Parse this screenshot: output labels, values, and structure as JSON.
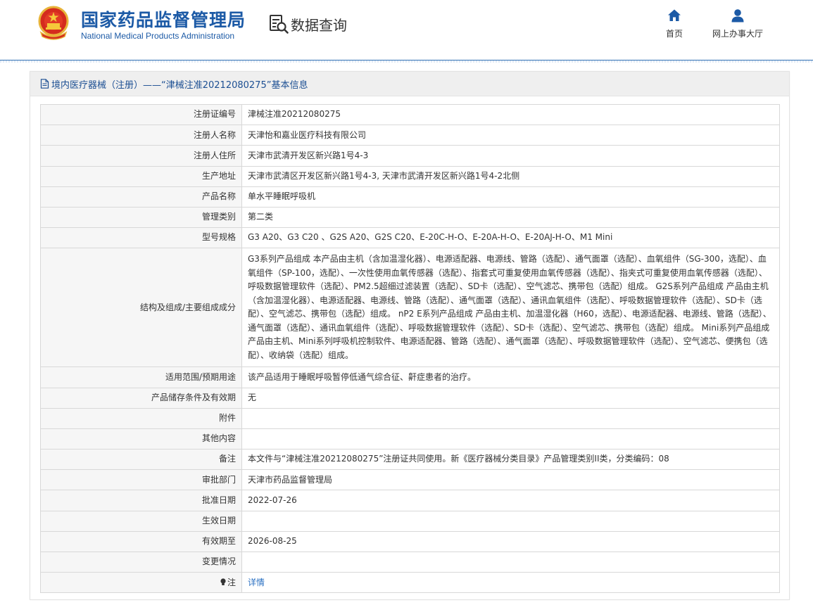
{
  "header": {
    "logo_cn": "国家药品监督管理局",
    "logo_en": "National Medical Products Administration",
    "query_label": "数据查询",
    "nav": [
      {
        "label": "首页",
        "icon": "home-icon"
      },
      {
        "label": "网上办事大厅",
        "icon": "user-icon"
      }
    ]
  },
  "panel": {
    "title": "境内医疗器械（注册）——“津械注准20212080275”基本信息"
  },
  "rows": [
    {
      "label": "注册证编号",
      "value": "津械注准20212080275"
    },
    {
      "label": "注册人名称",
      "value": "天津怡和嘉业医疗科技有限公司"
    },
    {
      "label": "注册人住所",
      "value": "天津市武清开发区新兴路1号4-3"
    },
    {
      "label": "生产地址",
      "value": "天津市武清区开发区新兴路1号4-3, 天津市武清开发区新兴路1号4-2北侧"
    },
    {
      "label": "产品名称",
      "value": "单水平睡眠呼吸机"
    },
    {
      "label": "管理类别",
      "value": "第二类"
    },
    {
      "label": "型号规格",
      "value": "G3 A20、G3 C20 、G2S A20、G2S C20、E-20C-H-O、E-20A-H-O、E-20AJ-H-O、M1 Mini"
    },
    {
      "label": "结构及组成/主要组成成分",
      "value": "G3系列产品组成 本产品由主机（含加温湿化器）、电源适配器、电源线、管路（选配）、通气面罩（选配）、血氧组件（SG-300，选配）、血氧组件（SP-100，选配）、一次性使用血氧传感器（选配）、指套式可重复使用血氧传感器（选配）、指夹式可重复使用血氧传感器（选配）、呼吸数据管理软件（选配）、PM2.5超细过滤装置（选配）、SD卡（选配）、空气滤芯、携带包（选配）组成。 G2S系列产品组成 产品由主机（含加温湿化器）、电源适配器、电源线、管路（选配）、通气面罩（选配）、通讯血氧组件（选配）、呼吸数据管理软件（选配）、SD卡（选配）、空气滤芯、携带包（选配）组成。 nP2 E系列产品组成 产品由主机、加温湿化器（H60，选配）、电源适配器、电源线、管路（选配）、通气面罩（选配）、通讯血氧组件（选配）、呼吸数据管理软件（选配）、SD卡（选配）、空气滤芯、携带包（选配）组成。 Mini系列产品组成 产品由主机、Mini系列呼吸机控制软件、电源适配器、管路（选配）、通气面罩（选配）、呼吸数据管理软件（选配）、空气滤芯、便携包（选配）、收纳袋（选配）组成。"
    },
    {
      "label": "适用范围/预期用途",
      "value": "该产品适用于睡眠呼吸暂停低通气综合征、鼾症患者的治疗。"
    },
    {
      "label": "产品储存条件及有效期",
      "value": "无"
    },
    {
      "label": "附件",
      "value": ""
    },
    {
      "label": "其他内容",
      "value": ""
    },
    {
      "label": "备注",
      "value": "本文件与“津械注准20212080275”注册证共同使用。新《医疗器械分类目录》产品管理类别II类，分类编码：08"
    },
    {
      "label": "审批部门",
      "value": "天津市药品监督管理局"
    },
    {
      "label": "批准日期",
      "value": "2022-07-26"
    },
    {
      "label": "生效日期",
      "value": ""
    },
    {
      "label": "有效期至",
      "value": "2026-08-25"
    },
    {
      "label": "变更情况",
      "value": ""
    },
    {
      "label": "注",
      "value": "详情"
    }
  ],
  "colors": {
    "brand": "#1c5aa6",
    "link": "#2a70c2",
    "title": "#1c4f93"
  }
}
